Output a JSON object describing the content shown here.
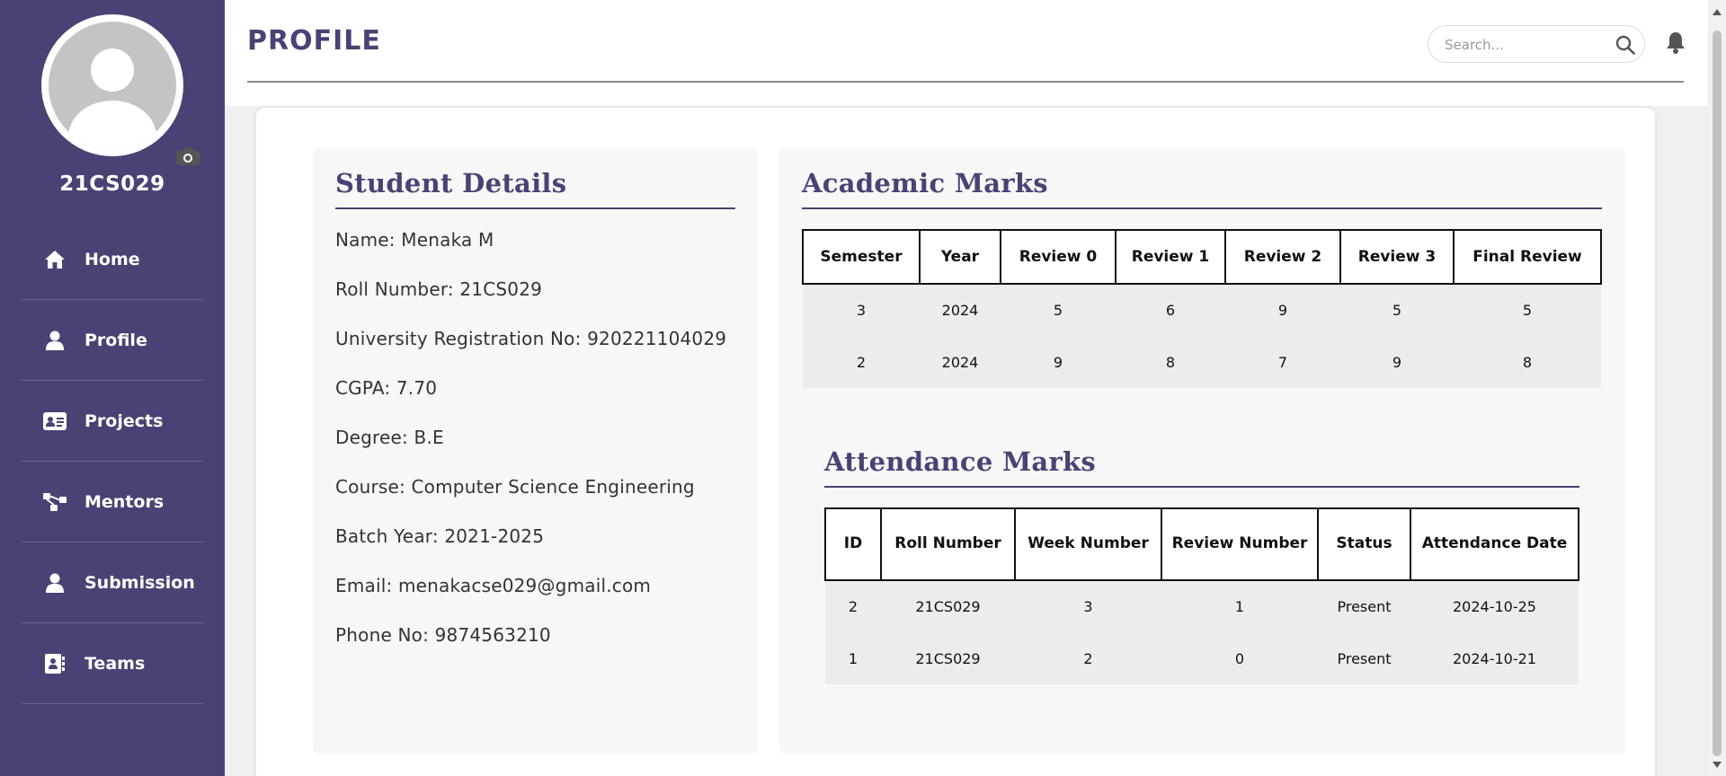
{
  "sidebar": {
    "user_id": "21CS029",
    "items": [
      {
        "label": "Home",
        "icon": "home-icon"
      },
      {
        "label": "Profile",
        "icon": "user-icon"
      },
      {
        "label": "Projects",
        "icon": "id-card-icon"
      },
      {
        "label": "Mentors",
        "icon": "network-icon"
      },
      {
        "label": "Submission",
        "icon": "user-icon"
      },
      {
        "label": "Teams",
        "icon": "address-book-icon"
      }
    ]
  },
  "header": {
    "title": "PROFILE",
    "search_placeholder": "Search..."
  },
  "student": {
    "title": "Student Details",
    "details": [
      "Name: Menaka M",
      "Roll Number: 21CS029",
      "University Registration No: 920221104029",
      "CGPA: 7.70",
      "Degree: B.E",
      "Course: Computer Science Engineering",
      "Batch Year: 2021-2025",
      "Email: menakacse029@gmail.com",
      "Phone No: 9874563210"
    ]
  },
  "academic": {
    "title": "Academic Marks",
    "columns": [
      "Semester",
      "Year",
      "Review 0",
      "Review 1",
      "Review 2",
      "Review 3",
      "Final Review"
    ],
    "rows": [
      [
        "3",
        "2024",
        "5",
        "6",
        "9",
        "5",
        "5"
      ],
      [
        "2",
        "2024",
        "9",
        "8",
        "7",
        "9",
        "8"
      ]
    ]
  },
  "attendance": {
    "title": "Attendance Marks",
    "columns": [
      "ID",
      "Roll Number",
      "Week Number",
      "Review Number",
      "Status",
      "Attendance Date"
    ],
    "rows": [
      [
        "2",
        "21CS029",
        "3",
        "1",
        "Present",
        "2024-10-25"
      ],
      [
        "1",
        "21CS029",
        "2",
        "0",
        "Present",
        "2024-10-21"
      ]
    ]
  },
  "colors": {
    "sidebar_bg": "#4a4274",
    "accent": "#4a4274",
    "panel_bg": "#f7f7f7"
  }
}
